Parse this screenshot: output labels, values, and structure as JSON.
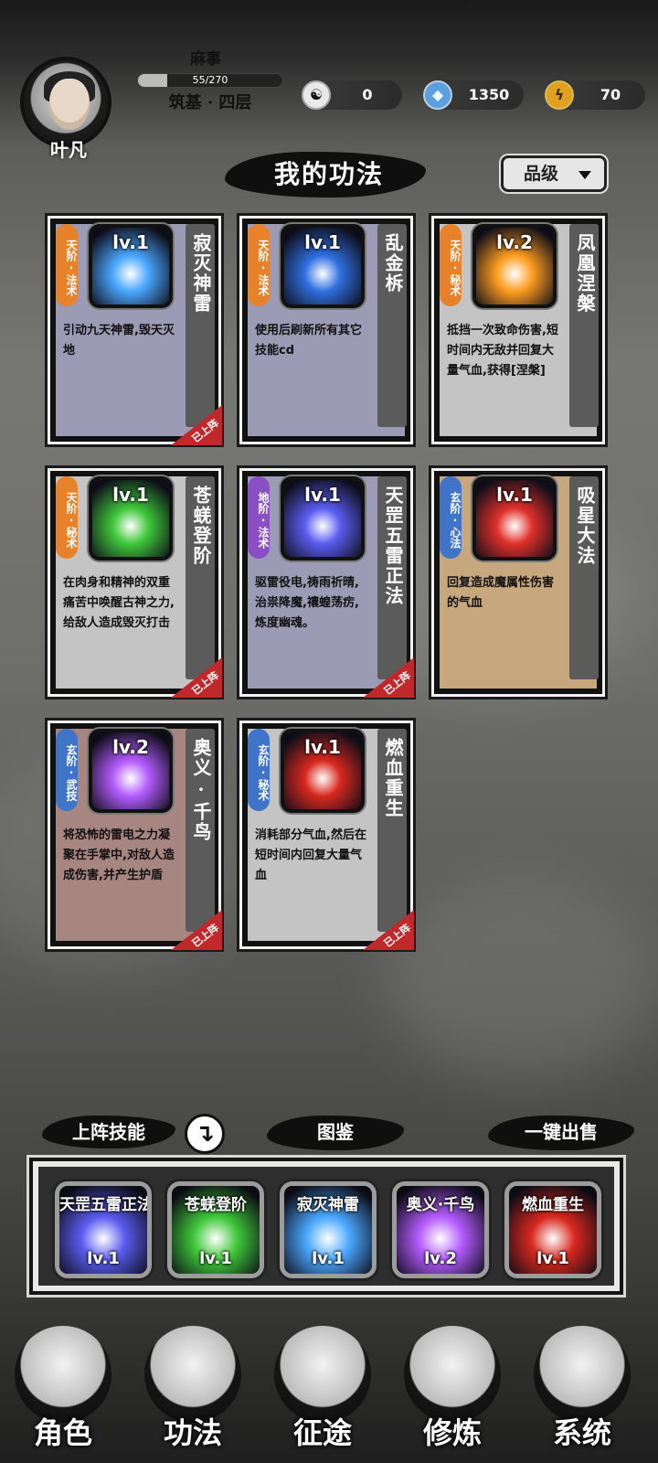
{
  "player": {
    "name": "叶凡",
    "title": "麻事",
    "exp_text": "55/270",
    "exp_fraction": 0.2037,
    "realm": "筑基 · 四层"
  },
  "resources": [
    {
      "icon": "yin-yang-icon",
      "value": "0"
    },
    {
      "icon": "crystal-icon",
      "value": "1350"
    },
    {
      "icon": "lightning-icon",
      "value": "70"
    }
  ],
  "page": {
    "title": "我的功法",
    "filter_label": "品级"
  },
  "skills": [
    {
      "rank": "天阶·法术",
      "rank_color": "#e8822a",
      "name": "寂灭神雷",
      "level": "lv.1",
      "desc": "引动九天神雷,毁天灭地",
      "card_bg": "#9c9bb6",
      "icon_color": "#4aa7ff",
      "equipped": true
    },
    {
      "rank": "天阶·法术",
      "rank_color": "#e8822a",
      "name": "乱金柝",
      "level": "lv.1",
      "desc": "使用后刷新所有其它技能cd",
      "card_bg": "#9c9bb6",
      "icon_color": "#2f6fe0",
      "equipped": false
    },
    {
      "rank": "天阶·秘术",
      "rank_color": "#e8822a",
      "name": "凤凰涅槃",
      "level": "lv.2",
      "desc": "抵挡一次致命伤害,短时间内无敌并回复大量气血,获得[涅槃]",
      "card_bg": "#c4c4c4",
      "icon_color": "#ff9d20",
      "equipped": false
    },
    {
      "rank": "天阶·秘术",
      "rank_color": "#e8822a",
      "name": "苍蜣登阶",
      "level": "lv.1",
      "desc": "在肉身和精神的双重痛苦中唤醒古神之力,给敌人造成毁灭打击",
      "card_bg": "#c4c4c4",
      "icon_color": "#3fc83a",
      "equipped": true
    },
    {
      "rank": "地阶·法术",
      "rank_color": "#8a4fc4",
      "name": "天罡五雷正法",
      "level": "lv.1",
      "desc": "驱雷役电,祷雨祈晴,治祟降魔,禳蝗荡疠,炼度幽魂。",
      "card_bg": "#9c9bb6",
      "icon_color": "#5a5cf0",
      "equipped": true
    },
    {
      "rank": "玄阶·心法",
      "rank_color": "#3f74c8",
      "name": "吸星大法",
      "level": "lv.1",
      "desc": "回复造成魔属性伤害的气血",
      "card_bg": "#c7a77d",
      "icon_color": "#e0302a",
      "equipped": false
    },
    {
      "rank": "玄阶·武技",
      "rank_color": "#3f74c8",
      "name": "奥义·千鸟",
      "level": "lv.2",
      "desc": "将恐怖的雷电之力凝聚在手掌中,对敌人造成伤害,并产生护盾",
      "card_bg": "#a78682",
      "icon_color": "#b45cff",
      "equipped": true
    },
    {
      "rank": "玄阶·秘术",
      "rank_color": "#3f74c8",
      "name": "燃血重生",
      "level": "lv.1",
      "desc": "消耗部分气血,然后在短时间内回复大量气血",
      "card_bg": "#c4c4c4",
      "icon_color": "#d8281e",
      "equipped": true
    }
  ],
  "equipped_badge": "已上阵",
  "sections": {
    "deployed": "上阵技能",
    "codex": "图鉴",
    "sell_all": "一键出售"
  },
  "loadout": [
    {
      "name": "天罡五雷正法",
      "level": "lv.1",
      "icon_color": "#5a5cf0"
    },
    {
      "name": "苍蜣登阶",
      "level": "lv.1",
      "icon_color": "#3fc83a"
    },
    {
      "name": "寂灭神雷",
      "level": "lv.1",
      "icon_color": "#4aa7ff"
    },
    {
      "name": "奥义·千鸟",
      "level": "lv.2",
      "icon_color": "#b45cff"
    },
    {
      "name": "燃血重生",
      "level": "lv.1",
      "icon_color": "#d8281e"
    }
  ],
  "nav": [
    {
      "label": "角色",
      "icon": "character-icon"
    },
    {
      "label": "功法",
      "icon": "skill-book-icon"
    },
    {
      "label": "征途",
      "icon": "journey-sword-icon"
    },
    {
      "label": "修炼",
      "icon": "meditation-icon"
    },
    {
      "label": "系统",
      "icon": "system-icon"
    }
  ]
}
